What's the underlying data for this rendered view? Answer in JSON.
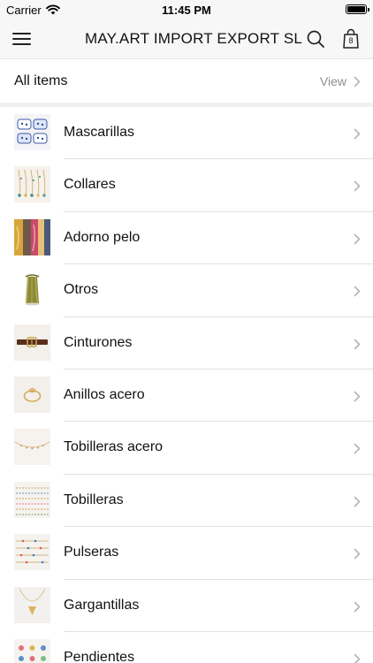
{
  "status_bar": {
    "carrier": "Carrier",
    "time": "11:45 PM"
  },
  "nav": {
    "title": "MAY.ART IMPORT EXPORT SL",
    "cart_count": "8"
  },
  "all_items": {
    "label": "All items",
    "action": "View"
  },
  "categories": [
    {
      "label": "Mascarillas",
      "thumb_icon": "face-masks-thumbnail"
    },
    {
      "label": "Collares",
      "thumb_icon": "necklaces-thumbnail"
    },
    {
      "label": "Adorno pelo",
      "thumb_icon": "hair-accessories-thumbnail"
    },
    {
      "label": "Otros",
      "thumb_icon": "other-items-thumbnail"
    },
    {
      "label": "Cinturones",
      "thumb_icon": "belt-thumbnail"
    },
    {
      "label": "Anillos acero",
      "thumb_icon": "steel-ring-thumbnail"
    },
    {
      "label": "Tobilleras acero",
      "thumb_icon": "steel-anklet-thumbnail"
    },
    {
      "label": "Tobilleras",
      "thumb_icon": "anklets-thumbnail"
    },
    {
      "label": "Pulseras",
      "thumb_icon": "bracelets-thumbnail"
    },
    {
      "label": "Gargantillas",
      "thumb_icon": "choker-thumbnail"
    },
    {
      "label": "Pendientes",
      "thumb_icon": "earrings-thumbnail"
    }
  ],
  "colors": {
    "bar_background": "#f7f7f7",
    "separator": "#e2e2e2",
    "secondary_text": "#8e8e93",
    "chevron": "#b5b5b5"
  }
}
